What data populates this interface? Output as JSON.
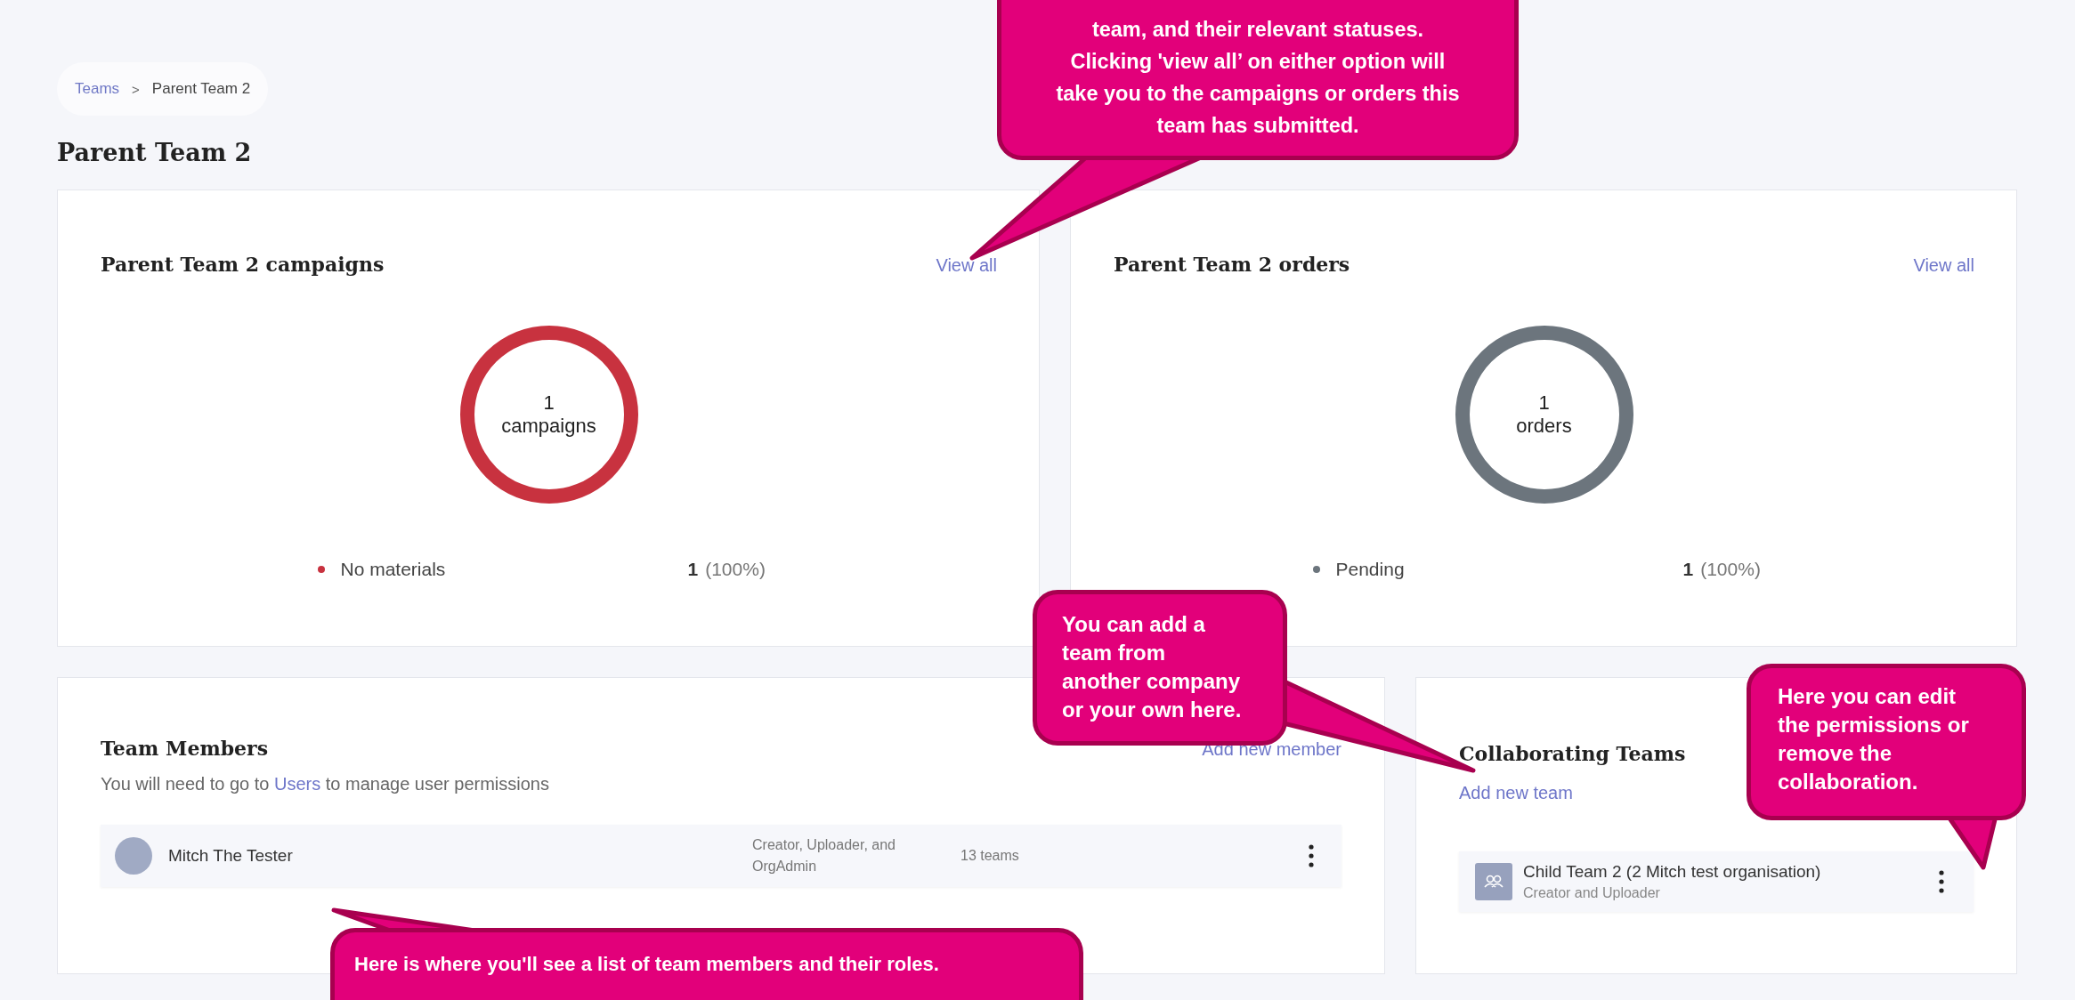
{
  "breadcrumb": [
    {
      "label": "Teams",
      "kind": "link"
    },
    {
      "label": "Parent Team 2",
      "kind": "current"
    }
  ],
  "breadcrumb_separator": ">",
  "page_title": "Parent Team 2",
  "summary_cards": [
    {
      "title": "Parent Team 2 campaigns",
      "view_all": "View all",
      "center_count": "1",
      "center_label": "campaigns",
      "legend": [
        {
          "label": "No materials",
          "count": "1",
          "percent": "(100%)",
          "color": "#c8323f"
        }
      ]
    },
    {
      "title": "Parent Team 2 orders",
      "view_all": "View all",
      "center_count": "1",
      "center_label": "orders",
      "legend": [
        {
          "label": "Pending",
          "count": "1",
          "percent": "(100%)",
          "color": "#6c757d"
        }
      ]
    }
  ],
  "team_members": {
    "title": "Team Members",
    "add_link": "Add new member",
    "note_before": "You will need to go to",
    "note_link": "Users",
    "note_after": "to manage user permissions",
    "members": [
      {
        "name": "Mitch The Tester",
        "roles": "Creator, Uploader, and OrgAdmin",
        "teams": "13 teams"
      }
    ]
  },
  "collaborating_teams": {
    "title": "Collaborating Teams",
    "add_link": "Add new team",
    "teams": [
      {
        "name": "Child Team 2 (2 Mitch test organisation)",
        "roles": "Creator and Uploader"
      }
    ]
  },
  "callouts": [
    {
      "lines": [
        "team, and their relevant statuses.",
        "Clicking 'view all’ on either option will",
        "take you to the campaigns or orders this",
        "team has submitted."
      ],
      "kind": "top"
    },
    {
      "lines": [
        "You can add a",
        "team from",
        "another company",
        "or your own here."
      ],
      "kind": "middle"
    },
    {
      "lines": [
        "Here you can edit",
        "the permissions or",
        "remove the",
        "collaboration."
      ],
      "kind": "right"
    },
    {
      "lines": [
        "Here is where you'll see a list of team members and their roles."
      ],
      "kind": "bottom"
    }
  ]
}
